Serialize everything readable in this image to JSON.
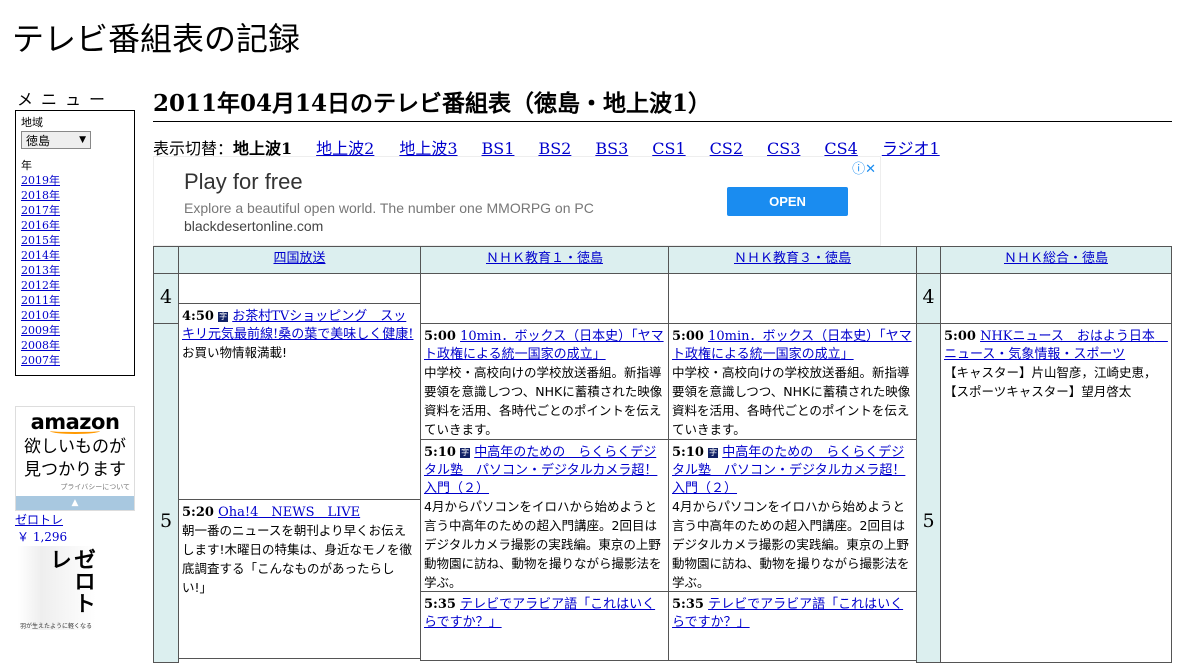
{
  "site_title": "テレビ番組表の記録",
  "menu": {
    "heading": "メニュー",
    "region_label": "地域",
    "region_value": "徳島",
    "year_label": "年",
    "years": [
      "2019年",
      "2018年",
      "2017年",
      "2016年",
      "2015年",
      "2014年",
      "2013年",
      "2012年",
      "2011年",
      "2010年",
      "2009年",
      "2008年",
      "2007年"
    ]
  },
  "amazon_ad": {
    "logo": "amazon",
    "copy1": "欲しいものが",
    "copy2": "見つかります",
    "privacy": "プライバシーについて"
  },
  "book": {
    "title": "ゼロトレ",
    "price": "￥ 1,296",
    "cover_title": "ゼロトレ",
    "cover_sub": "羽が生えたように軽くなる"
  },
  "page_title": "2011年04月14日のテレビ番組表（徳島・地上波1）",
  "switcher": {
    "label": "表示切替：",
    "current": "地上波1",
    "links": [
      "地上波2",
      "地上波3",
      "BS1",
      "BS2",
      "BS3",
      "CS1",
      "CS2",
      "CS3",
      "CS4",
      "ラジオ1"
    ]
  },
  "ad": {
    "headline": "Play for free",
    "desc": "Explore a beautiful open world. The number one MMORPG on PC",
    "url": "blackdesertonline.com",
    "cta": "OPEN"
  },
  "channels": [
    "四国放送",
    "ＮＨＫ教育１・徳島",
    "ＮＨＫ教育３・徳島",
    "ＮＨＫ総合・徳島"
  ],
  "hours": [
    "4",
    "5"
  ],
  "programs": {
    "shikoku_0450": {
      "time": "4:50",
      "title": "お茶村TVショッピング　スッキリ元気最前線!桑の葉で美味しく健康!",
      "desc": "お買い物情報満載!"
    },
    "shikoku_0520": {
      "time": "5:20",
      "title": "Oha!4　NEWS　LIVE",
      "desc": "朝一番のニュースを朝刊より早くお伝えします!木曜日の特集は、身近なモノを徹底調査する「こんなものがあったらしい!」"
    },
    "edu_0500": {
      "time": "5:00",
      "title": "10min．ボックス（日本史）「ヤマト政権による統一国家の成立」",
      "desc": "中学校・高校向けの学校放送番組。新指導要領を意識しつつ、NHKに蓄積された映像資料を活用、各時代ごとのポイントを伝えていきます。"
    },
    "edu_0510": {
      "time": "5:10",
      "title": "中高年のための　らくらくデジタル塾　パソコン・デジタルカメラ超！入門（２）",
      "desc": "4月からパソコンをイロハから始めようと言う中高年のための超入門講座。2回目はデジタルカメラ撮影の実践編。東京の上野動物園に訪ね、動物を撮りながら撮影法を学ぶ。"
    },
    "edu_0535": {
      "time": "5:35",
      "title": "テレビでアラビア語「これはいくらですか？」"
    },
    "sogo_0500": {
      "time": "5:00",
      "title": "NHKニュース　おはよう日本　ニュース・気象情報・スポーツ",
      "desc": "【キャスター】片山智彦，江崎史恵，【スポーツキャスター】望月啓太"
    }
  },
  "icons": {
    "data_broadcast": "字"
  }
}
